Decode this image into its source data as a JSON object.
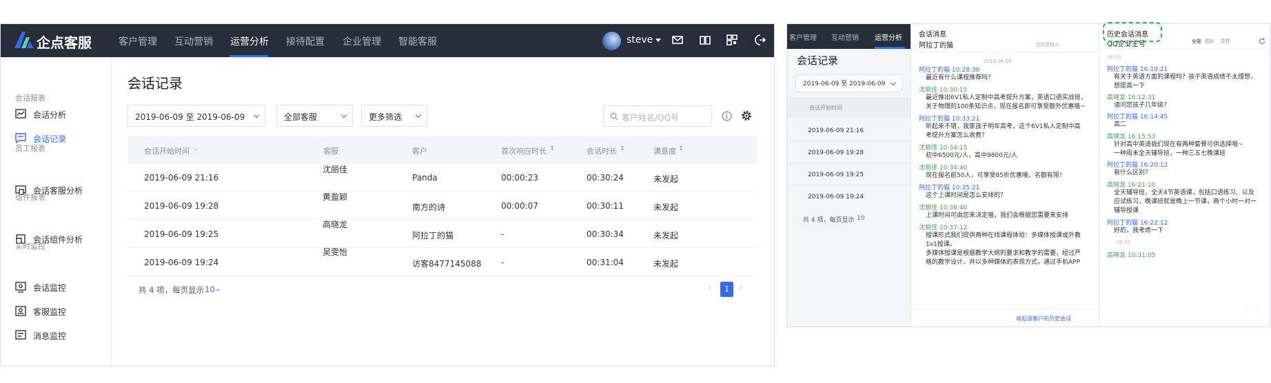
{
  "left_app": {
    "brand": "企点客服",
    "nav": [
      "客户管理",
      "互动营销",
      "运营分析",
      "接待配置",
      "企业管理",
      "智能客服"
    ],
    "active_nav": "运营分析",
    "user": "steve",
    "sidebar": {
      "groups": [
        {
          "title": "会话报表",
          "items": [
            "会话分析",
            "会话记录"
          ]
        },
        {
          "title": "员工报表",
          "items": [
            "会话客服分析"
          ]
        },
        {
          "title": "组件报表",
          "items": [
            "会话组件分析"
          ]
        },
        {
          "title": "实时监控",
          "items": [
            "会话监控",
            "客服监控",
            "消息监控"
          ]
        }
      ],
      "active_item": "会话记录"
    },
    "page_title": "会话记录",
    "filters": {
      "date_range": "2019-06-09 至 2019-06-09",
      "agent": "全部客服",
      "more": "更多筛选",
      "search_placeholder": "客户姓名/QQ号"
    },
    "table": {
      "columns": [
        "会话开始时间",
        "客服",
        "客户",
        "首次响应时长",
        "会话时长",
        "满意度"
      ],
      "rows": [
        [
          "2019-06-09 21:16",
          "沈丽佳",
          "Panda",
          "00:00:23",
          "00:30:24",
          "未发起"
        ],
        [
          "2019-06-09 19:28",
          "黄盈颖",
          "南方的诗",
          "00:00:07",
          "00:30:11",
          "未发起"
        ],
        [
          "2019-06-09 19:25",
          "高晓龙",
          "阿拉丁的猫",
          "-",
          "00:30:34",
          "未发起"
        ],
        [
          "2019-06-09 19:24",
          "吴雯怡",
          "访客8477145088",
          "-",
          "00:31:04",
          "未发起"
        ]
      ]
    },
    "pagination": {
      "total_text": "共 4 项，每页显示",
      "page_size": "10",
      "current_page": "1"
    }
  },
  "right_app": {
    "nav": [
      "客户管理",
      "互动营销",
      "运营分析"
    ],
    "page_title": "会话记录",
    "date_range": "2019-06-09 至 2019-06-09",
    "column_header": "会话开始时间",
    "times": [
      "2019-06-09 21:16",
      "2019-06-09 19:28",
      "2019-06-09 19:25",
      "2019-06-09 19:24"
    ],
    "pagination_text": "共 4 项，每页显示",
    "page_size": "10",
    "chat": {
      "title": "会话消息",
      "customer": "阿拉丁的猫",
      "receiver_label": "当前接待人：",
      "date": "2019-06-09",
      "messages": [
        {
          "sender": "阿拉丁的猫 10:28:30",
          "side": "customer",
          "lines": [
            "最近有什么课程推荐吗？"
          ]
        },
        {
          "sender": "沈丽佳 10:30:15",
          "side": "agent",
          "lines": [
            "最近推出6V1私人定制中高考提升方案，英语口语实战班，",
            "关于物理的100条知识点，现在报名即可享受额外优惠哦~"
          ]
        },
        {
          "sender": "阿拉丁的猫 10:33:21",
          "side": "customer",
          "lines": [
            "听起来不错，我家孩子明年高考，这个6V1私人定制中高",
            "考提升方案怎么收费？"
          ]
        },
        {
          "sender": "沈丽佳 10:34:15",
          "side": "agent",
          "lines": [
            "初中6500元/人，高中9800元/人"
          ]
        },
        {
          "sender": "沈丽佳 10:34:40",
          "side": "agent",
          "lines": [
            "现在报名前50人，可享受85折优惠哦，名额有限！"
          ]
        },
        {
          "sender": "阿拉丁的猫 10:35:21",
          "side": "customer",
          "lines": [
            "这个上课时间是怎么安排的？"
          ]
        },
        {
          "sender": "沈丽佳 10:36:40",
          "side": "agent",
          "lines": [
            "上课时间可由您来决定哦，我们会根据您需要来安排"
          ]
        },
        {
          "sender": "沈丽佳 10:37:12",
          "side": "agent",
          "lines": [
            "授课形式我们提供两种在线课程体验：多媒体授课或外教",
            "1v1授课。",
            "多媒体授课是根据教学大纲的要求和教学的需要，经过严",
            "格的教学设计，并以多种媒体的表现方式，通过手机APP"
          ]
        }
      ],
      "collapse_link": "收起该客户的历史会话"
    },
    "history": {
      "title": "历史会话消息",
      "account": "QQ企业主号",
      "filters": [
        "全部",
        "图片",
        "文件"
      ],
      "date1": "06-09",
      "date2": "06-10",
      "messages": [
        {
          "sender": "阿拉丁的猫 16:10:21",
          "side": "customer",
          "lines": [
            "有关于英语方面的课程吗？孩子英语成绩不太理想，",
            "想提高一下"
          ]
        },
        {
          "sender": "高晓龙 16:12:31",
          "side": "agent",
          "lines": [
            "请问您孩子几年级？"
          ]
        },
        {
          "sender": "阿拉丁的猫 16:14:45",
          "side": "customer",
          "lines": [
            "高二"
          ]
        },
        {
          "sender": "高晓龙 16:15:53",
          "side": "agent",
          "lines": [
            "针对高中英语我们现在有两种套餐可供选择哦~",
            "一种周末全天辅导班，一种三五七晚课班"
          ]
        },
        {
          "sender": "阿拉丁的猫 16:20:12",
          "side": "customer",
          "lines": [
            "有什么区别？"
          ]
        },
        {
          "sender": "高晓龙 16:21:10",
          "side": "agent",
          "lines": [
            "全天辅导班，全天4节英语课，包括口语练习、以及",
            "应试练习，晚课班就是晚上一节课，两个小时一对一",
            "辅导授课"
          ]
        },
        {
          "sender": "阿拉丁的猫 16:22:12",
          "side": "customer",
          "lines": [
            "好的，我考虑一下"
          ]
        },
        {
          "sender": "高晓龙 10:31:05",
          "side": "agent",
          "lines": []
        }
      ]
    }
  },
  "colors": {
    "primary": "#2f6cf6",
    "nav_bg": "#272e3a",
    "agent_green": "#3fa34d",
    "highlight": "#1fba52"
  }
}
